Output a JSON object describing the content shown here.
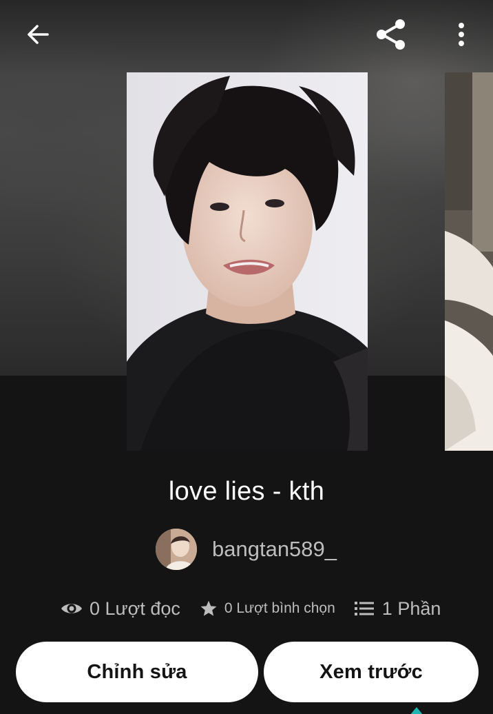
{
  "header": {
    "back_icon": "arrow-left-icon",
    "share_icon": "share-icon",
    "more_icon": "more-vertical-icon"
  },
  "story": {
    "title": "love lies - kth",
    "author": "bangtan589_"
  },
  "stats": {
    "reads_icon": "eye-icon",
    "reads": "0 Lượt đọc",
    "votes_icon": "star-icon",
    "votes": "0 Lượt bình chọn",
    "parts_icon": "list-icon",
    "parts": "1 Phần"
  },
  "actions": {
    "edit_label": "Chỉnh sửa",
    "preview_label": "Xem trước"
  },
  "colors": {
    "background": "#141414",
    "button_bg": "#ffffff",
    "secondary_text": "#bdbdbd",
    "accent": "#1fb5b5"
  }
}
